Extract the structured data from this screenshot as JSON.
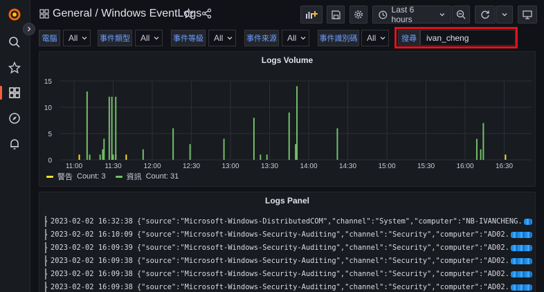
{
  "topbar": {
    "title": "General / Windows EventLogs",
    "time_range": "Last 6 hours"
  },
  "variables": [
    {
      "label": "電腦",
      "value": "All"
    },
    {
      "label": "事件類型",
      "value": "All"
    },
    {
      "label": "事件等級",
      "value": "All"
    },
    {
      "label": "事件來源",
      "value": "All"
    },
    {
      "label": "事件識別碼",
      "value": "All"
    }
  ],
  "search": {
    "label": "搜尋",
    "value": "ivan_cheng"
  },
  "volume_panel": {
    "title": "Logs Volume",
    "legend": [
      {
        "name": "警告",
        "count_text": "Count: 3",
        "color": "#fade2a"
      },
      {
        "name": "資訊",
        "count_text": "Count: 31",
        "color": "#73bf69"
      }
    ]
  },
  "chart_data": {
    "type": "bar",
    "title": "Logs Volume",
    "y_ticks": [
      "0",
      "5",
      "10",
      "15"
    ],
    "ylim": [
      0,
      15
    ],
    "x_ticks": [
      "11:00",
      "11:30",
      "12:00",
      "12:30",
      "13:00",
      "13:30",
      "14:00",
      "14:30",
      "15:00",
      "15:30",
      "16:00",
      "16:30"
    ],
    "grid": true,
    "legend_position": "bottom-left",
    "series": [
      {
        "name": "警告",
        "color": "#fade2a",
        "points": [
          [
            "11:04",
            1
          ],
          [
            "11:32",
            1
          ],
          [
            "11:40",
            1
          ],
          [
            "16:31",
            1
          ]
        ]
      },
      {
        "name": "資訊",
        "color": "#73bf69",
        "points": [
          [
            "11:10",
            13
          ],
          [
            "11:12",
            1
          ],
          [
            "11:20",
            1
          ],
          [
            "11:22",
            2
          ],
          [
            "11:23",
            4
          ],
          [
            "11:27",
            12
          ],
          [
            "11:29",
            12
          ],
          [
            "11:30",
            1
          ],
          [
            "11:32",
            12
          ],
          [
            "11:53",
            2
          ],
          [
            "12:16",
            6
          ],
          [
            "12:29",
            3
          ],
          [
            "12:55",
            4
          ],
          [
            "13:18",
            8
          ],
          [
            "13:23",
            1
          ],
          [
            "13:28",
            1
          ],
          [
            "13:45",
            9
          ],
          [
            "13:50",
            3
          ],
          [
            "13:51",
            14
          ],
          [
            "14:22",
            6
          ],
          [
            "16:09",
            4
          ],
          [
            "16:12",
            2
          ],
          [
            "16:14",
            7
          ]
        ]
      }
    ]
  },
  "logs_panel": {
    "title": "Logs Panel",
    "rows": [
      {
        "time": "2023-02-02 16:32:38",
        "json": "{\"source\":\"Microsoft-Windows-DistributedCOM\",\"channel\":\"System\",\"computer\":\"NB-IVANCHENG."
      },
      {
        "time": "2023-02-02 16:10:09",
        "json": "{\"source\":\"Microsoft-Windows-Security-Auditing\",\"channel\":\"Security\",\"computer\":\"AD02."
      },
      {
        "time": "2023-02-02 16:09:39",
        "json": "{\"source\":\"Microsoft-Windows-Security-Auditing\",\"channel\":\"Security\",\"computer\":\"AD02."
      },
      {
        "time": "2023-02-02 16:09:38",
        "json": "{\"source\":\"Microsoft-Windows-Security-Auditing\",\"channel\":\"Security\",\"computer\":\"AD02."
      },
      {
        "time": "2023-02-02 16:09:38",
        "json": "{\"source\":\"Microsoft-Windows-Security-Auditing\",\"channel\":\"Security\",\"computer\":\"AD02."
      },
      {
        "time": "2023-02-02 16:09:38",
        "json": "{\"source\":\"Microsoft-Windows-Security-Auditing\",\"channel\":\"Security\",\"computer\":\"AD02."
      }
    ]
  }
}
